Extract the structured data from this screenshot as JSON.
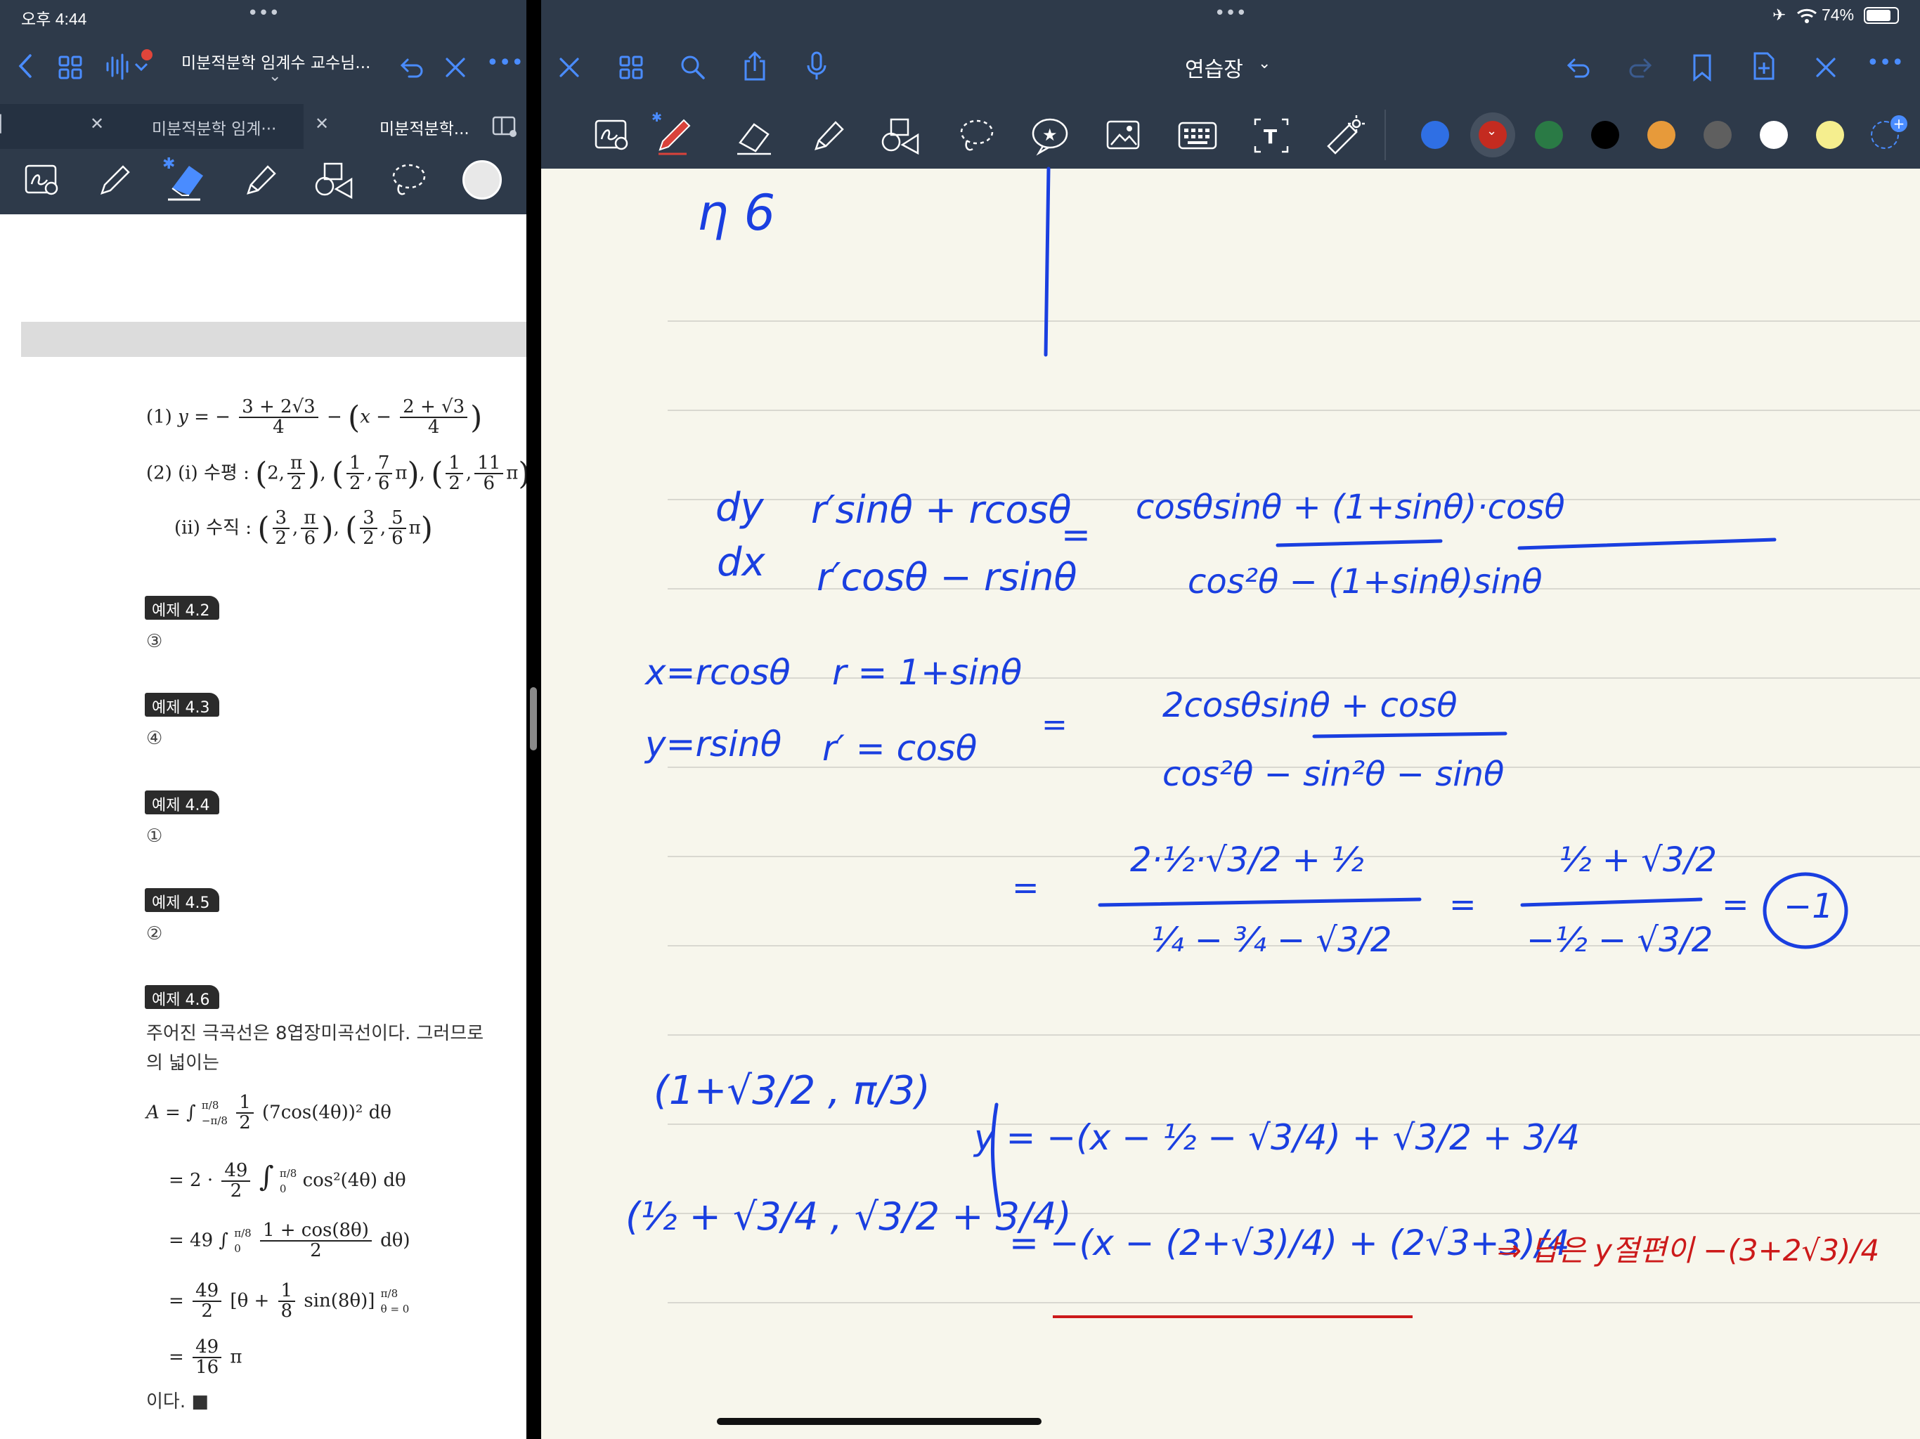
{
  "status_left": {
    "time": "오후 4:44"
  },
  "status_right": {
    "battery": "74%"
  },
  "left_header": {
    "title": "미분적분학 임계수 교수님...",
    "title_short": "미분적분학 임계수 교수님..."
  },
  "left_tabs": [
    {
      "label": "미분적분학 임계···"
    },
    {
      "label": "미분적분학..."
    }
  ],
  "right_header": {
    "title": "연습장"
  },
  "colors": {
    "toolbar_bg": "#2e3a4a",
    "accent": "#3b82f6",
    "paper": "#f7f6ec",
    "ink_blue": "#1a3fe0",
    "ink_red": "#cc1a1a"
  },
  "swatches": [
    "#2f6fe4",
    "#c42b20",
    "#2a7a45",
    "#000000",
    "#e79a3a",
    "#5f5f5f",
    "#ffffff",
    "#f5ee8e"
  ],
  "icons": {
    "left": [
      "back-icon",
      "grid-icon",
      "audio-icon",
      "undo-icon",
      "close-icon",
      "more-icon"
    ],
    "right": [
      "close-icon",
      "grid-icon",
      "search-icon",
      "share-icon",
      "mic-icon",
      "undo-icon",
      "redo-icon",
      "bookmark-icon",
      "add-page-icon",
      "close-icon",
      "more-icon"
    ]
  },
  "doc": {
    "line1_label": "(1)",
    "line1_y": "y = −",
    "line1_f1_num": "3 + 2√3",
    "line1_f1_den": "4",
    "line1_mid": "−",
    "line1_x": "x −",
    "line1_f2_num": "2 + √3",
    "line1_f2_den": "4",
    "line2_label": "(2)  (i) 수평 :",
    "line2_p1": "2,",
    "line2_p1_num": "π",
    "line2_p1_den": "2",
    "line2_p2_num1": "1",
    "line2_p2_den1": "2",
    "line2_p2_num2": "7",
    "line2_p2_den2": "6",
    "line2_pi": "π",
    "line2_p3_num1": "1",
    "line2_p3_den1": "2",
    "line2_p3_num2": "11",
    "line2_p3_den2": "6",
    "line3_label": "(ii) 수직 :",
    "line3_p1_num1": "3",
    "line3_p1_den1": "2",
    "line3_p1_num2": "π",
    "line3_p1_den2": "6",
    "line3_p2_num1": "3",
    "line3_p2_den1": "2",
    "line3_p2_num2": "5",
    "line3_p2_den2": "6",
    "examples": [
      {
        "badge": "예제 4.2",
        "answer": "③"
      },
      {
        "badge": "예제 4.3",
        "answer": "④"
      },
      {
        "badge": "예제 4.4",
        "answer": "①"
      },
      {
        "badge": "예제 4.5",
        "answer": "②"
      },
      {
        "badge": "예제 4.6",
        "answer": ""
      }
    ],
    "ex46_text1": "주어진 극곡선은 8엽장미곡선이다. 그러므로",
    "ex46_text2": "의 넓이는",
    "eq1": "A = ∫",
    "eq1_up": "π/8",
    "eq1_lo": "−π/8",
    "eq1_frac_num": "1",
    "eq1_frac_den": "2",
    "eq1_rest": "(7cos(4θ))² dθ",
    "eq2_pre": "= 2 ·",
    "eq2_num": "49",
    "eq2_den": "2",
    "eq2_int": "∫",
    "eq2_up": "π/8",
    "eq2_lo": "0",
    "eq2_rest": "cos²(4θ) dθ",
    "eq3_pre": "= 49 ∫",
    "eq3_up": "π/8",
    "eq3_lo": "0",
    "eq3_num": "1 + cos(8θ)",
    "eq3_den": "2",
    "eq3_rest": "dθ)",
    "eq4_pre": "=",
    "eq4_num": "49",
    "eq4_den": "2",
    "eq4_mid": "[θ +",
    "eq4_num2": "1",
    "eq4_den2": "8",
    "eq4_rest": "sin(8θ)]",
    "eq4_up": "π/8",
    "eq4_lo": "θ = 0",
    "eq5_pre": "=",
    "eq5_num": "49",
    "eq5_den": "16",
    "eq5_rest": "π",
    "end": "이다. ■"
  },
  "notes": {
    "top": "η  6",
    "dydx_l": "dy",
    "dydx_d": "dx",
    "eq_a_num": "r′sinθ + rcosθ",
    "eq_a_den": "r′cosθ − rsinθ",
    "eq_b_num": "cosθsinθ + (1+sinθ)·cosθ",
    "eq_b_den": "cos²θ − (1+sinθ)sinθ",
    "sub1a": "x=rcosθ",
    "sub1b": "r = 1+sinθ",
    "sub2a": "y=rsinθ",
    "sub2b": "r′ = cosθ",
    "eq_c_num": "2cosθsinθ + cosθ",
    "eq_c_den": "cos²θ − sin²θ − sinθ",
    "eq_d_num": "2·½·√3/2 + ½",
    "eq_d_den": "¼ − ¾ − √3/2",
    "eq_e_num": "½ + √3/2",
    "eq_e_den": "−½ − √3/2",
    "result": "−1",
    "pt1": "(1+√3/2 , π/3)",
    "pt2": "(½ + √3/4 , √3/2 + 3/4)",
    "line_y1": "y = −(x − ½ − √3/4) + √3/2 + 3/4",
    "line_y2": "= −(x − (2+√3)/4) + (2√3+3)/4",
    "answer_red": "⇒ 답은 y절편이 −(3+2√3)/4"
  }
}
